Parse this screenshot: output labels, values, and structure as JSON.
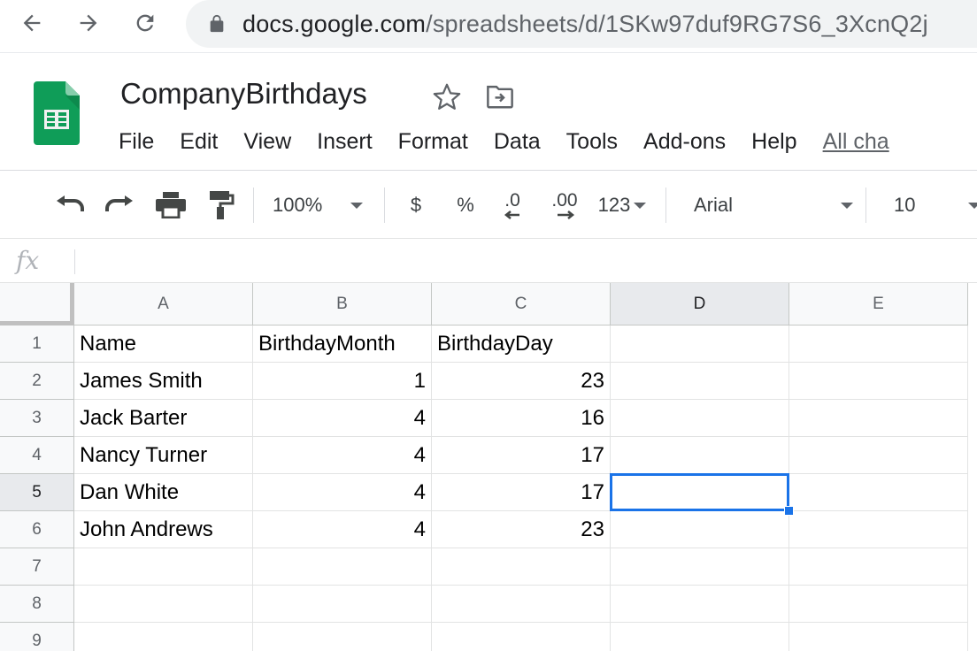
{
  "browser": {
    "url_host": "docs.google.com",
    "url_path": "/spreadsheets/d/1SKw97duf9RG7S6_3XcnQ2j",
    "icons": [
      "back-arrow-icon",
      "forward-arrow-icon",
      "reload-icon",
      "lock-icon"
    ]
  },
  "doc": {
    "title": "CompanyBirthdays",
    "menu": [
      "File",
      "Edit",
      "View",
      "Insert",
      "Format",
      "Data",
      "Tools",
      "Add-ons",
      "Help",
      "All cha"
    ]
  },
  "toolbar": {
    "zoom": "100%",
    "currency": "$",
    "percent": "%",
    "decrease_decimals": ".0",
    "increase_decimals": ".00",
    "more_formats": "123",
    "font": "Arial",
    "font_size": "10"
  },
  "formula_bar": {
    "fx_label": "fx",
    "value": ""
  },
  "sheet": {
    "columns": [
      "A",
      "B",
      "C",
      "D",
      "E"
    ],
    "row_numbers": [
      "1",
      "2",
      "3",
      "4",
      "5",
      "6",
      "7",
      "8",
      "9"
    ],
    "rows": [
      [
        "Name",
        "BirthdayMonth",
        "BirthdayDay",
        "",
        ""
      ],
      [
        "James Smith",
        "1",
        "23",
        "",
        ""
      ],
      [
        "Jack Barter",
        "4",
        "16",
        "",
        ""
      ],
      [
        "Nancy Turner",
        "4",
        "17",
        "",
        ""
      ],
      [
        "Dan White",
        "4",
        "17",
        "",
        ""
      ],
      [
        "John Andrews",
        "4",
        "23",
        "",
        ""
      ],
      [
        "",
        "",
        "",
        "",
        ""
      ],
      [
        "",
        "",
        "",
        "",
        ""
      ],
      [
        "",
        "",
        "",
        "",
        ""
      ]
    ],
    "selected_cell": "D5",
    "selection_color": "#1a73e8"
  }
}
